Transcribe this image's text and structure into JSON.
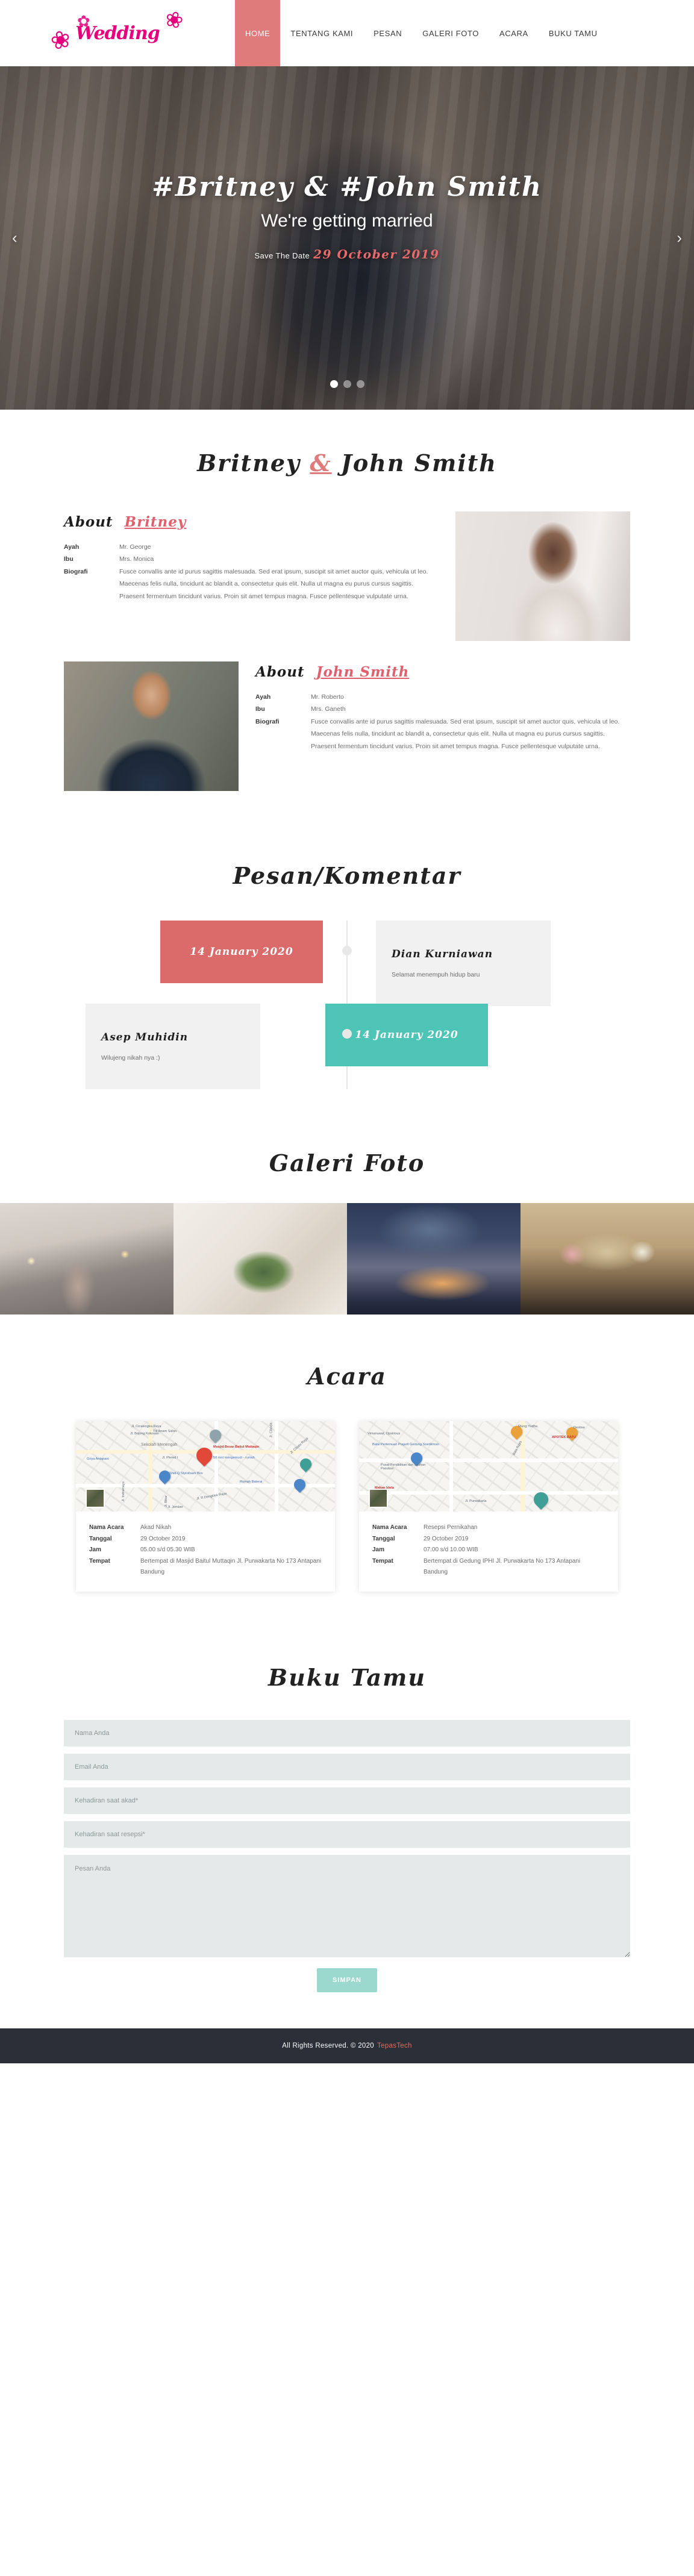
{
  "brand": {
    "text": "Wedding"
  },
  "nav": {
    "items": [
      {
        "label": "HOME",
        "active": true
      },
      {
        "label": "TENTANG KAMI",
        "active": false
      },
      {
        "label": "PESAN",
        "active": false
      },
      {
        "label": "GALERI FOTO",
        "active": false
      },
      {
        "label": "ACARA",
        "active": false
      },
      {
        "label": "BUKU TAMU",
        "active": false
      }
    ]
  },
  "hero": {
    "names": "#Britney & #John Smith",
    "subtitle": "We're getting married",
    "save_label": "Save The Date",
    "save_date": "29 October 2019",
    "prev_arrow": "‹",
    "next_arrow": "›",
    "slides_total": 3,
    "active_slide": 1
  },
  "about": {
    "title_left": "Britney",
    "title_amp": "&",
    "title_right": "John Smith",
    "bride": {
      "heading_prefix": "About",
      "heading_name": "Britney",
      "rows": [
        {
          "key": "Ayah",
          "value": "Mr. George"
        },
        {
          "key": "Ibu",
          "value": "Mrs. Monica"
        },
        {
          "key": "Biografi",
          "value": "Fusce convallis ante id purus sagittis malesuada. Sed erat ipsum, suscipit sit amet auctor quis, vehicula ut leo. Maecenas felis nulla, tincidunt ac blandit a, consectetur quis elit. Nulla ut magna eu purus cursus sagittis. Praesent fermentum tincidunt varius. Proin sit amet tempus magna. Fusce pellentesque vulputate urna."
        }
      ]
    },
    "groom": {
      "heading_prefix": "About",
      "heading_name": "John Smith",
      "rows": [
        {
          "key": "Ayah",
          "value": "Mr. Roberto"
        },
        {
          "key": "Ibu",
          "value": "Mrs. Ganeth"
        },
        {
          "key": "Biografi",
          "value": "Fusce convallis ante id purus sagittis malesuada. Sed erat ipsum, suscipit sit amet auctor quis, vehicula ut leo. Maecenas felis nulla, tincidunt ac blandit a, consectetur quis elit. Nulla ut magna eu purus cursus sagittis. Praesent fermentum tincidunt varius. Proin sit amet tempus magna. Fusce pellentesque vulputate urna."
        }
      ]
    }
  },
  "pesan": {
    "title": "Pesan/Komentar",
    "entries": [
      {
        "date": "14 January 2020",
        "name": "Dian Kurniawan",
        "message": "Selamat menempuh hidup baru",
        "date_side": "left",
        "date_color": "#db6a6a"
      },
      {
        "date": "14 January 2020",
        "name": "Asep Muhidin",
        "message": "Wilujeng nikah nya :)",
        "date_side": "right",
        "date_color": "#4dc4b6"
      }
    ]
  },
  "gallery": {
    "title": "Galeri Foto",
    "count": 4
  },
  "acara": {
    "title": "Acara",
    "cards": [
      {
        "map_labels": [
          "Titi Anam Salon",
          "Masjid Besar Baitul Muttaqin",
          "58 mnt mengemudi - rumah",
          "Griya Antapani",
          "Shid-Q Styrofoam Box",
          "Rumah Baterai",
          "Jl. Plered I",
          "Jl. Cibatu Raya",
          "Jl. R.Dengklok Raya",
          "Jl. Cicalengka Raya",
          "Jl. Bojong Kokosan",
          "Sekolah Menengah",
          "Jl. Indramayu",
          "Jl. Blitar",
          "Jl. Jember",
          "Jl. Ciboda"
        ],
        "rows": [
          {
            "key": "Nama Acara",
            "value": "Akad Nikah"
          },
          {
            "key": "Tanggal",
            "value": "29 October 2019"
          },
          {
            "key": "Jam",
            "value": "05.00 s/d 05.30 WIB"
          },
          {
            "key": "Tempat",
            "value": "Bertempat di Masjid Baitul Muttaqin Jl. Purwakarta No 173 Antapani Bandung"
          }
        ]
      },
      {
        "map_labels": [
          "Riung Yudha",
          "Destisa",
          "APOTEK BATU",
          "Vimanuwat, Opsirious",
          "Balai Pertemuan Prajurit Gedung Soedirman",
          "Pusat Pendidikan dan Latihan Pasukan",
          "Makan Idola",
          "Jl. Purwakarta",
          "Bata Raya"
        ],
        "rows": [
          {
            "key": "Nama Acara",
            "value": "Resepsi Pernikahan"
          },
          {
            "key": "Tanggal",
            "value": "29 October 2019"
          },
          {
            "key": "Jam",
            "value": "07.00 s/d 10.00 WIB"
          },
          {
            "key": "Tempat",
            "value": "Bertempat di Gedung IPHI Jl. Purwakarta No 173 Antapani Bandung"
          }
        ]
      }
    ]
  },
  "tamu": {
    "title": "Buku Tamu",
    "fields": [
      {
        "name": "nama",
        "placeholder": "Nama Anda",
        "value": ""
      },
      {
        "name": "email",
        "placeholder": "Email Anda",
        "value": ""
      },
      {
        "name": "kehadiran_akad",
        "placeholder": "Kehadiran saat akad*",
        "value": ""
      },
      {
        "name": "kehadiran_resepsi",
        "placeholder": "Kehadiran saat resepsi*",
        "value": ""
      }
    ],
    "message_placeholder": "Pesan Anda",
    "message_value": "",
    "submit_label": "SIMPAN"
  },
  "footer": {
    "text": "All Rights Reserved. © 2020",
    "credit": "TepasTech"
  },
  "colors": {
    "accent_pink": "#e07b7b",
    "brand_magenta": "#e6007e",
    "teal": "#4dc4b6",
    "button_teal": "#9bd9cf",
    "footer_bg": "#2b2f38",
    "field_bg": "#e4eaea"
  }
}
